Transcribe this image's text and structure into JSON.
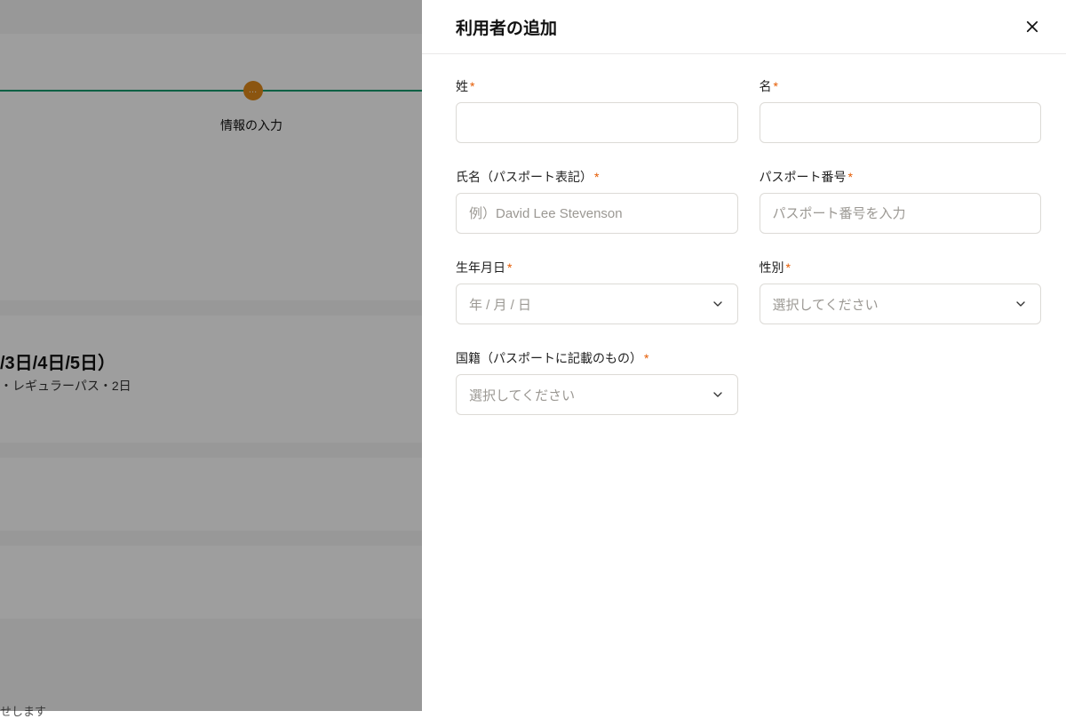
{
  "background": {
    "stepper_label": "情報の入力",
    "days_heading": "/3日/4日/5日）",
    "pass_subheading": "・レギュラーパス・2日",
    "footer_fragment": "せします"
  },
  "modal": {
    "title": "利用者の追加",
    "fields": {
      "last_name": {
        "label": "姓"
      },
      "first_name": {
        "label": "名"
      },
      "full_name_passport": {
        "label": "氏名（パスポート表記）",
        "placeholder": "例）David Lee Stevenson"
      },
      "passport_number": {
        "label": "パスポート番号",
        "placeholder": "パスポート番号を入力"
      },
      "birthdate": {
        "label": "生年月日",
        "placeholder": "年 / 月 / 日"
      },
      "gender": {
        "label": "性別",
        "placeholder": "選択してください"
      },
      "nationality": {
        "label": "国籍（パスポートに記載のもの）",
        "placeholder": "選択してください"
      }
    }
  }
}
